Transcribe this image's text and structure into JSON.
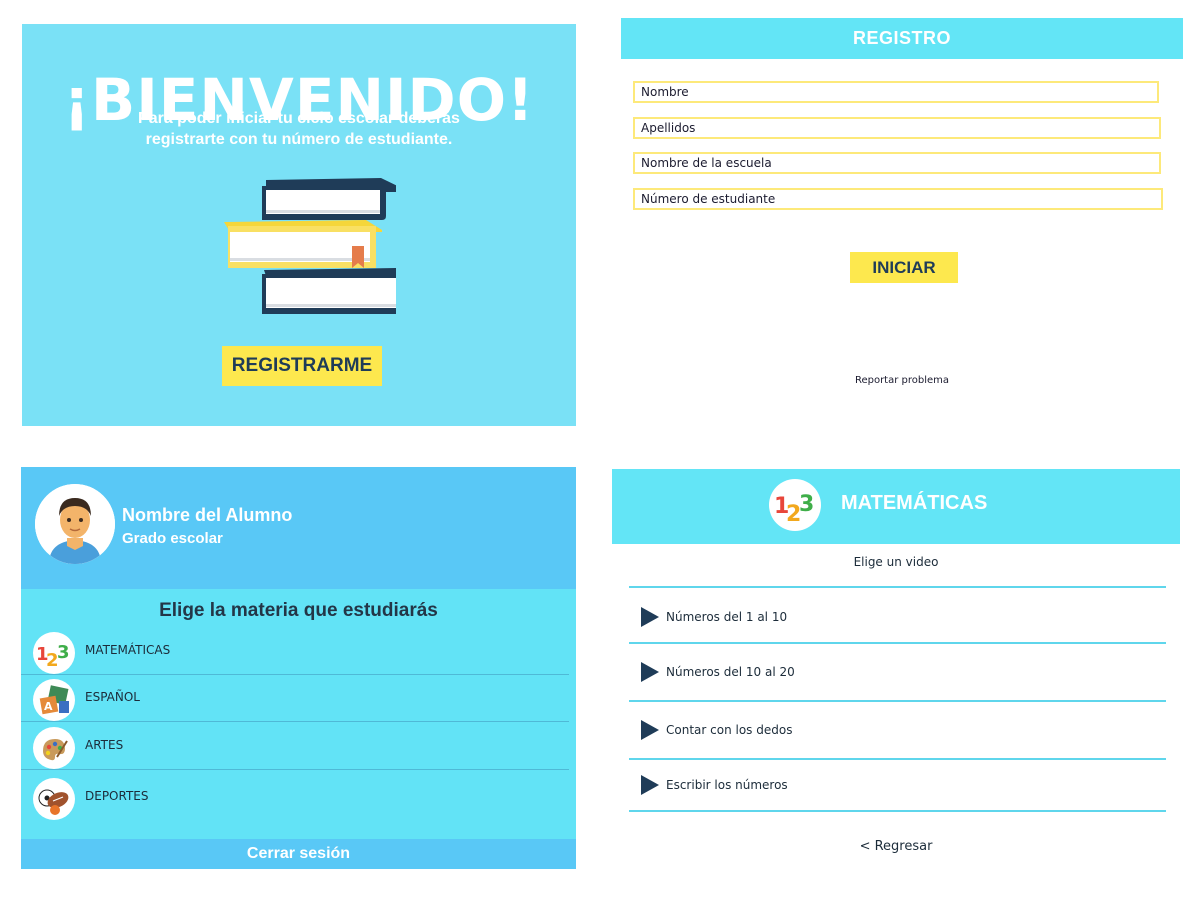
{
  "welcome": {
    "title": "¡BIENVENIDO!",
    "subtitle": "Para poder iniciar tu ciclo escolar deberás registrarte con tu número de estudiante.",
    "register_button": "REGISTRARME",
    "illustration_icon": "books-stack-icon"
  },
  "registro": {
    "header": "REGISTRO",
    "fields": [
      {
        "placeholder": "Nombre"
      },
      {
        "placeholder": "Apellidos"
      },
      {
        "placeholder": "Nombre de la escuela"
      },
      {
        "placeholder": "Número de estudiante"
      }
    ],
    "start_button": "INICIAR",
    "report_link": "Reportar problema"
  },
  "alumno": {
    "name": "Nombre del Alumno",
    "grade": "Grado escolar",
    "avatar_icon": "student-avatar-icon",
    "choose_title": "Elige la materia que estudiarás",
    "subjects": [
      {
        "label": "MATEMÁTICAS",
        "icon": "numbers-123-icon"
      },
      {
        "label": "ESPAÑOL",
        "icon": "alphabet-blocks-icon"
      },
      {
        "label": "ARTES",
        "icon": "palette-icon"
      },
      {
        "label": "DEPORTES",
        "icon": "sports-balls-icon"
      }
    ],
    "logout": "Cerrar sesión"
  },
  "matematicas": {
    "title": "MATEMÁTICAS",
    "logo_icon": "numbers-123-icon",
    "subtitle": "Elige un video",
    "videos": [
      {
        "label": "Números del 1 al 10"
      },
      {
        "label": "Números del 10 al 20"
      },
      {
        "label": "Contar con los dedos"
      },
      {
        "label": "Escribir los números"
      }
    ],
    "back_link": "< Regresar"
  },
  "colors": {
    "welcome_bg": "#7ae1f6",
    "header_cyan": "#63e5f6",
    "profile_blue": "#59c8f6",
    "button_yellow": "#fde84e",
    "field_border": "#fde97a",
    "dark_navy": "#1f3c58"
  }
}
